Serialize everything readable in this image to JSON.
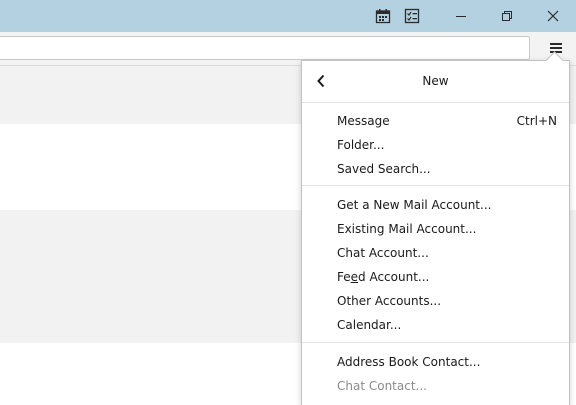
{
  "titlebar": {
    "icons": [
      "calendar-icon",
      "tasks-icon"
    ],
    "window_controls": [
      "minimize-icon",
      "restore-icon",
      "close-icon"
    ]
  },
  "toolbar": {
    "menu_icon": "hamburger-menu-icon"
  },
  "new_menu": {
    "title": "New",
    "back_icon": "chevron-left-icon",
    "groups": [
      [
        {
          "label": "Message",
          "shortcut": "Ctrl+N"
        },
        {
          "label": "Folder..."
        },
        {
          "label": "Saved Search..."
        }
      ],
      [
        {
          "label": "Get a New Mail Account..."
        },
        {
          "label": "Existing Mail Account...",
          "highlighted": true
        },
        {
          "label": "Chat Account..."
        },
        {
          "label_pre": "Fe",
          "label_accel": "e",
          "label_post": "d Account..."
        },
        {
          "label": "Other Accounts..."
        },
        {
          "label": "Calendar..."
        }
      ],
      [
        {
          "label": "Address Book Contact..."
        },
        {
          "label": "Chat Contact...",
          "disabled": true
        }
      ]
    ]
  },
  "colors": {
    "titlebar": "#b4d1e2",
    "highlight": "#fff600",
    "disabled_text": "#8a8a8a"
  }
}
